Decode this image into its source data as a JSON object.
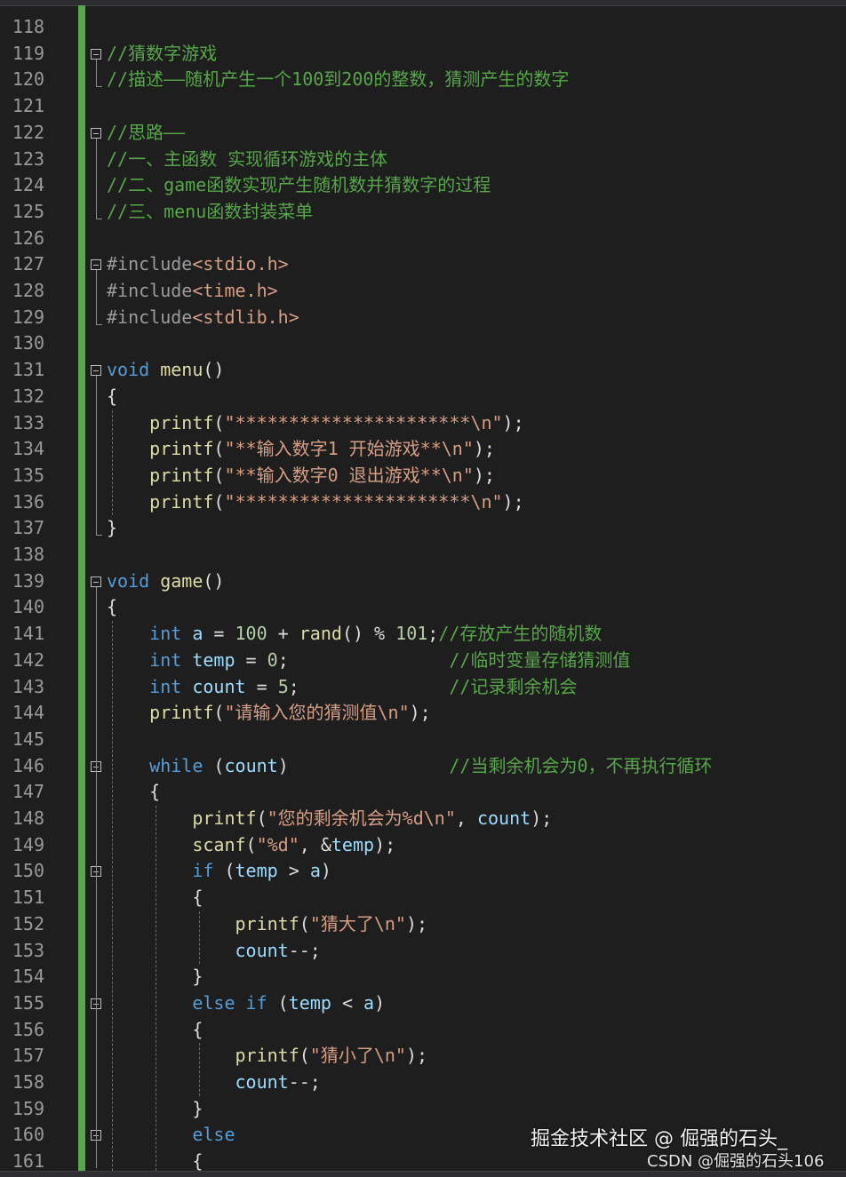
{
  "editor": {
    "lines": [
      {
        "n": "118",
        "tokens": []
      },
      {
        "n": "119",
        "tokens": [
          {
            "c": "cm",
            "t": "//猜数字游戏"
          }
        ]
      },
      {
        "n": "120",
        "tokens": [
          {
            "c": "cm",
            "t": "//描述——随机产生一个100到200的整数，猜测产生的数字"
          }
        ]
      },
      {
        "n": "121",
        "tokens": []
      },
      {
        "n": "122",
        "tokens": [
          {
            "c": "cm",
            "t": "//思路——"
          }
        ]
      },
      {
        "n": "123",
        "tokens": [
          {
            "c": "cm",
            "t": "//一、主函数 实现循环游戏的主体"
          }
        ]
      },
      {
        "n": "124",
        "tokens": [
          {
            "c": "cm",
            "t": "//二、game函数实现产生随机数并猜数字的过程"
          }
        ]
      },
      {
        "n": "125",
        "tokens": [
          {
            "c": "cm",
            "t": "//三、menu函数封装菜单"
          }
        ]
      },
      {
        "n": "126",
        "tokens": []
      },
      {
        "n": "127",
        "tokens": [
          {
            "c": "pp",
            "t": "#include"
          },
          {
            "c": "inc",
            "t": "<stdio.h>"
          }
        ]
      },
      {
        "n": "128",
        "tokens": [
          {
            "c": "pp",
            "t": "#include"
          },
          {
            "c": "inc",
            "t": "<time.h>"
          }
        ]
      },
      {
        "n": "129",
        "tokens": [
          {
            "c": "pp",
            "t": "#include"
          },
          {
            "c": "inc",
            "t": "<stdlib.h>"
          }
        ]
      },
      {
        "n": "130",
        "tokens": []
      },
      {
        "n": "131",
        "tokens": [
          {
            "c": "kw",
            "t": "void"
          },
          {
            "c": "",
            "t": " "
          },
          {
            "c": "fn",
            "t": "menu"
          },
          {
            "c": "",
            "t": "()"
          }
        ]
      },
      {
        "n": "132",
        "tokens": [
          {
            "c": "",
            "t": "{"
          }
        ]
      },
      {
        "n": "133",
        "tokens": [
          {
            "c": "",
            "t": "    "
          },
          {
            "c": "fn",
            "t": "printf"
          },
          {
            "c": "",
            "t": "("
          },
          {
            "c": "str",
            "t": "\"**********************\\n\""
          },
          {
            "c": "",
            "t": ");"
          }
        ]
      },
      {
        "n": "134",
        "tokens": [
          {
            "c": "",
            "t": "    "
          },
          {
            "c": "fn",
            "t": "printf"
          },
          {
            "c": "",
            "t": "("
          },
          {
            "c": "str",
            "t": "\"**输入数字1 开始游戏**\\n\""
          },
          {
            "c": "",
            "t": ");"
          }
        ]
      },
      {
        "n": "135",
        "tokens": [
          {
            "c": "",
            "t": "    "
          },
          {
            "c": "fn",
            "t": "printf"
          },
          {
            "c": "",
            "t": "("
          },
          {
            "c": "str",
            "t": "\"**输入数字0 退出游戏**\\n\""
          },
          {
            "c": "",
            "t": ");"
          }
        ]
      },
      {
        "n": "136",
        "tokens": [
          {
            "c": "",
            "t": "    "
          },
          {
            "c": "fn",
            "t": "printf"
          },
          {
            "c": "",
            "t": "("
          },
          {
            "c": "str",
            "t": "\"**********************\\n\""
          },
          {
            "c": "",
            "t": ");"
          }
        ]
      },
      {
        "n": "137",
        "tokens": [
          {
            "c": "",
            "t": "}"
          }
        ]
      },
      {
        "n": "138",
        "tokens": []
      },
      {
        "n": "139",
        "tokens": [
          {
            "c": "kw",
            "t": "void"
          },
          {
            "c": "",
            "t": " "
          },
          {
            "c": "fn",
            "t": "game"
          },
          {
            "c": "",
            "t": "()"
          }
        ]
      },
      {
        "n": "140",
        "tokens": [
          {
            "c": "",
            "t": "{"
          }
        ]
      },
      {
        "n": "141",
        "tokens": [
          {
            "c": "",
            "t": "    "
          },
          {
            "c": "kw",
            "t": "int"
          },
          {
            "c": "",
            "t": " "
          },
          {
            "c": "var",
            "t": "a"
          },
          {
            "c": "",
            "t": " = "
          },
          {
            "c": "num",
            "t": "100"
          },
          {
            "c": "",
            "t": " + "
          },
          {
            "c": "fn",
            "t": "rand"
          },
          {
            "c": "",
            "t": "() % "
          },
          {
            "c": "num",
            "t": "101"
          },
          {
            "c": "",
            "t": ";"
          },
          {
            "c": "cm",
            "t": "//存放产生的随机数"
          }
        ]
      },
      {
        "n": "142",
        "tokens": [
          {
            "c": "",
            "t": "    "
          },
          {
            "c": "kw",
            "t": "int"
          },
          {
            "c": "",
            "t": " "
          },
          {
            "c": "var",
            "t": "temp"
          },
          {
            "c": "",
            "t": " = "
          },
          {
            "c": "num",
            "t": "0"
          },
          {
            "c": "",
            "t": ";               "
          },
          {
            "c": "cm",
            "t": "//临时变量存储猜测值"
          }
        ]
      },
      {
        "n": "143",
        "tokens": [
          {
            "c": "",
            "t": "    "
          },
          {
            "c": "kw",
            "t": "int"
          },
          {
            "c": "",
            "t": " "
          },
          {
            "c": "var",
            "t": "count"
          },
          {
            "c": "",
            "t": " = "
          },
          {
            "c": "num",
            "t": "5"
          },
          {
            "c": "",
            "t": ";              "
          },
          {
            "c": "cm",
            "t": "//记录剩余机会"
          }
        ]
      },
      {
        "n": "144",
        "tokens": [
          {
            "c": "",
            "t": "    "
          },
          {
            "c": "fn",
            "t": "printf"
          },
          {
            "c": "",
            "t": "("
          },
          {
            "c": "str",
            "t": "\"请输入您的猜测值\\n\""
          },
          {
            "c": "",
            "t": ");"
          }
        ]
      },
      {
        "n": "145",
        "tokens": []
      },
      {
        "n": "146",
        "tokens": [
          {
            "c": "",
            "t": "    "
          },
          {
            "c": "kw",
            "t": "while"
          },
          {
            "c": "",
            "t": " ("
          },
          {
            "c": "var",
            "t": "count"
          },
          {
            "c": "",
            "t": ")               "
          },
          {
            "c": "cm",
            "t": "//当剩余机会为0，不再执行循环"
          }
        ]
      },
      {
        "n": "147",
        "tokens": [
          {
            "c": "",
            "t": "    {"
          }
        ]
      },
      {
        "n": "148",
        "tokens": [
          {
            "c": "",
            "t": "        "
          },
          {
            "c": "fn",
            "t": "printf"
          },
          {
            "c": "",
            "t": "("
          },
          {
            "c": "str",
            "t": "\"您的剩余机会为%d\\n\""
          },
          {
            "c": "",
            "t": ", "
          },
          {
            "c": "var",
            "t": "count"
          },
          {
            "c": "",
            "t": ");"
          }
        ]
      },
      {
        "n": "149",
        "tokens": [
          {
            "c": "",
            "t": "        "
          },
          {
            "c": "fn",
            "t": "scanf"
          },
          {
            "c": "",
            "t": "("
          },
          {
            "c": "str",
            "t": "\"%d\""
          },
          {
            "c": "",
            "t": ", &"
          },
          {
            "c": "var",
            "t": "temp"
          },
          {
            "c": "",
            "t": ");"
          }
        ]
      },
      {
        "n": "150",
        "tokens": [
          {
            "c": "",
            "t": "        "
          },
          {
            "c": "kw",
            "t": "if"
          },
          {
            "c": "",
            "t": " ("
          },
          {
            "c": "var",
            "t": "temp"
          },
          {
            "c": "",
            "t": " > "
          },
          {
            "c": "var",
            "t": "a"
          },
          {
            "c": "",
            "t": ")"
          }
        ]
      },
      {
        "n": "151",
        "tokens": [
          {
            "c": "",
            "t": "        {"
          }
        ]
      },
      {
        "n": "152",
        "tokens": [
          {
            "c": "",
            "t": "            "
          },
          {
            "c": "fn",
            "t": "printf"
          },
          {
            "c": "",
            "t": "("
          },
          {
            "c": "str",
            "t": "\"猜大了\\n\""
          },
          {
            "c": "",
            "t": ");"
          }
        ]
      },
      {
        "n": "153",
        "tokens": [
          {
            "c": "",
            "t": "            "
          },
          {
            "c": "var",
            "t": "count"
          },
          {
            "c": "",
            "t": "--;"
          }
        ]
      },
      {
        "n": "154",
        "tokens": [
          {
            "c": "",
            "t": "        }"
          }
        ]
      },
      {
        "n": "155",
        "tokens": [
          {
            "c": "",
            "t": "        "
          },
          {
            "c": "kw",
            "t": "else"
          },
          {
            "c": "",
            "t": " "
          },
          {
            "c": "kw",
            "t": "if"
          },
          {
            "c": "",
            "t": " ("
          },
          {
            "c": "var",
            "t": "temp"
          },
          {
            "c": "",
            "t": " < "
          },
          {
            "c": "var",
            "t": "a"
          },
          {
            "c": "",
            "t": ")"
          }
        ]
      },
      {
        "n": "156",
        "tokens": [
          {
            "c": "",
            "t": "        {"
          }
        ]
      },
      {
        "n": "157",
        "tokens": [
          {
            "c": "",
            "t": "            "
          },
          {
            "c": "fn",
            "t": "printf"
          },
          {
            "c": "",
            "t": "("
          },
          {
            "c": "str",
            "t": "\"猜小了\\n\""
          },
          {
            "c": "",
            "t": ");"
          }
        ]
      },
      {
        "n": "158",
        "tokens": [
          {
            "c": "",
            "t": "            "
          },
          {
            "c": "var",
            "t": "count"
          },
          {
            "c": "",
            "t": "--;"
          }
        ]
      },
      {
        "n": "159",
        "tokens": [
          {
            "c": "",
            "t": "        }"
          }
        ]
      },
      {
        "n": "160",
        "tokens": [
          {
            "c": "",
            "t": "        "
          },
          {
            "c": "kw",
            "t": "else"
          }
        ]
      },
      {
        "n": "161",
        "tokens": [
          {
            "c": "",
            "t": "        {"
          }
        ]
      }
    ]
  },
  "watermark": {
    "line1": "掘金技术社区 @ 倔强的石头_",
    "line2": "CSDN @倔强的石头106"
  },
  "colors": {
    "background": "#1e1e1e",
    "change_bar": "#57a64a",
    "keyword": "#569cd6",
    "comment": "#57a64a",
    "string": "#d69d85",
    "function": "#dcdcaa",
    "variable": "#9cdcfe"
  }
}
